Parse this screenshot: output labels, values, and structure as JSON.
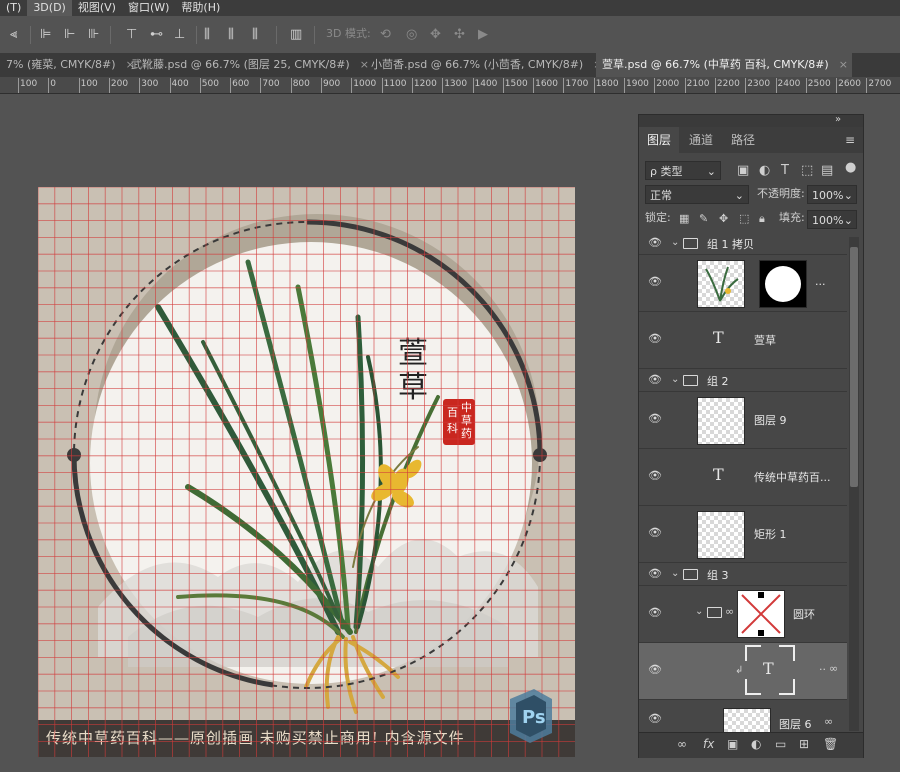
{
  "menu": [
    {
      "label": "(T)",
      "active": false
    },
    {
      "label": "3D(D)",
      "active": true
    },
    {
      "label": "视图(V)",
      "active": false
    },
    {
      "label": "窗口(W)",
      "active": false
    },
    {
      "label": "帮助(H)",
      "active": false
    }
  ],
  "options_bar": {
    "mode_3d_label": "3D 模式:"
  },
  "tabs": [
    {
      "label": "7% (雍菜, CMYK/8#)",
      "active": false
    },
    {
      "label": "武靴藤.psd @ 66.7% (图层 25, CMYK/8#)",
      "active": false
    },
    {
      "label": "小茴香.psd @ 66.7% (小茴香, CMYK/8#)",
      "active": false
    },
    {
      "label": "萱草.psd @ 66.7% (中草药 百科, CMYK/8#)",
      "active": true
    }
  ],
  "tab_close": "×",
  "ruler_labels": [
    "100",
    "0",
    "100",
    "200",
    "300",
    "400",
    "500",
    "600",
    "700",
    "800",
    "900",
    "1000",
    "1100",
    "1200",
    "1300",
    "1400",
    "1500",
    "1600",
    "1700",
    "1800",
    "1900",
    "2000",
    "2100",
    "2200",
    "2300",
    "2400",
    "2500",
    "2600",
    "2700"
  ],
  "canvas": {
    "title_chars": "萱草",
    "seal_chars": [
      "中",
      "草",
      "药",
      "百",
      "科"
    ],
    "banner": "传统中草药百科——原创插画 未购买禁止商用! 内含源文件",
    "grid_color": "#d23a3a",
    "ring_color": "#3a3a3a"
  },
  "panel": {
    "tabs": [
      {
        "label": "图层",
        "active": true
      },
      {
        "label": "通道",
        "active": false
      },
      {
        "label": "路径",
        "active": false
      }
    ],
    "filter_label": "ρ 类型",
    "blend_mode": "正常",
    "opacity_label": "不透明度:",
    "opacity_value": "100%",
    "lock_label": "锁定:",
    "fill_label": "填充:",
    "fill_value": "100%",
    "layers": [
      {
        "type": "group",
        "name": "组 1 拷贝"
      },
      {
        "type": "image-mask",
        "name": "..."
      },
      {
        "type": "text",
        "name": "萱草"
      },
      {
        "type": "group",
        "name": "组 2"
      },
      {
        "type": "image",
        "name": "图层 9"
      },
      {
        "type": "text",
        "name": "传统中草药百..."
      },
      {
        "type": "shape",
        "name": "矩形 1"
      },
      {
        "type": "group",
        "name": "组 3"
      },
      {
        "type": "group-linked",
        "name": "圆环"
      },
      {
        "type": "text-selected",
        "name": ""
      },
      {
        "type": "image",
        "name": "图层 6"
      }
    ]
  }
}
